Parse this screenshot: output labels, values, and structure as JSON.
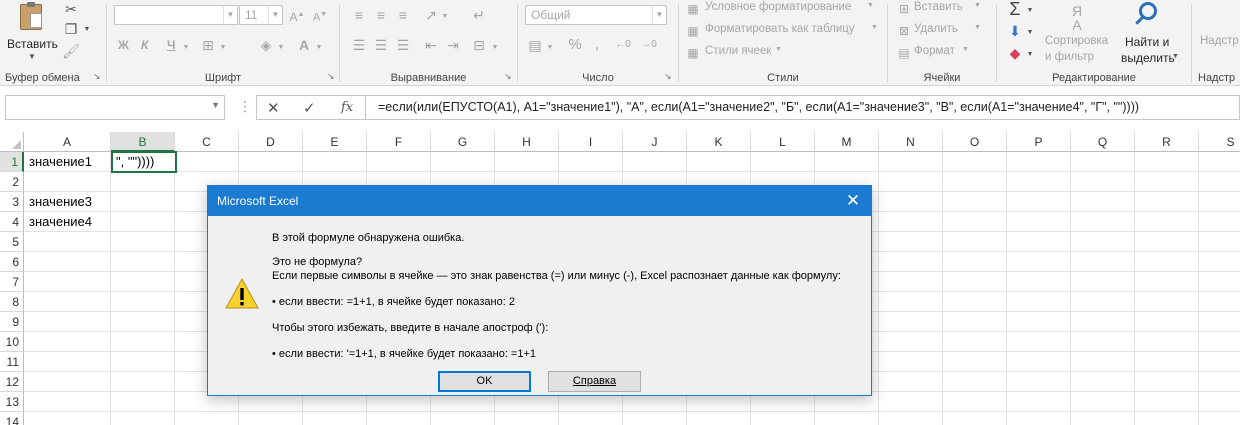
{
  "ribbon": {
    "clipboard": {
      "paste_label": "Вставить",
      "group_label": "Буфер обмена"
    },
    "font": {
      "name_value": "",
      "size_value": "11",
      "bold": "Ж",
      "italic": "К",
      "underline": "Ч",
      "group_label": "Шрифт"
    },
    "alignment": {
      "group_label": "Выравнивание"
    },
    "number": {
      "format_value": "Общий",
      "group_label": "Число"
    },
    "styles": {
      "conditional": "Условное форматирование",
      "table": "Форматировать как таблицу",
      "cell_styles": "Стили ячеек",
      "group_label": "Стили"
    },
    "cells": {
      "insert": "Вставить",
      "delete": "Удалить",
      "format": "Формат",
      "group_label": "Ячейки"
    },
    "editing": {
      "sort_line1": "Сортировка",
      "sort_line2": "и фильтр",
      "find_line1": "Найти и",
      "find_line2": "выделить",
      "group_label": "Редактирование"
    },
    "addins": {
      "label_top": "Надстр",
      "group_label": "Надстр"
    }
  },
  "formula_bar": {
    "name_box": "",
    "cancel_icon": "✕",
    "enter_icon": "✓",
    "fx_label": "fx",
    "formula": "=если(или(ЕПУСТО(A1), A1=\"значение1\"), \"A\", если(A1=\"значение2\", \"Б\", если(A1=\"значение3\", \"В\", если(A1=\"значение4\", \"Г\", \"\"))))"
  },
  "grid": {
    "columns": [
      "A",
      "B",
      "C",
      "D",
      "E",
      "F",
      "G",
      "H",
      "I",
      "J",
      "K",
      "L",
      "M",
      "N",
      "O",
      "P",
      "Q",
      "R",
      "S"
    ],
    "rows": [
      "1",
      "2",
      "3",
      "4",
      "5",
      "6",
      "7",
      "8",
      "9",
      "10",
      "11",
      "12",
      "13",
      "14"
    ],
    "cells": {
      "A1": "значение1",
      "A3": "значение3",
      "A4": "значение4"
    },
    "active_cell_text": "\", \"\"))))"
  },
  "dialog": {
    "title": "Microsoft Excel",
    "line1": "В этой формуле обнаружена ошибка.",
    "line2": "Это не формула?",
    "line3": "Если первые символы в ячейке — это знак равенства (=) или минус (-), Excel распознает данные как формулу:",
    "line4": "• если ввести: =1+1, в ячейке будет показано: 2",
    "line5": "Чтобы этого избежать, введите в начале апостроф ('):",
    "line6": "• если ввести: '=1+1, в ячейке будет показано: =1+1",
    "ok_label": "OK",
    "help_label": "Справка",
    "icon": "warning-icon"
  },
  "colors": {
    "accent": "#217346",
    "dialog_title": "#1a7bd0",
    "warning": "#f7d12c"
  }
}
